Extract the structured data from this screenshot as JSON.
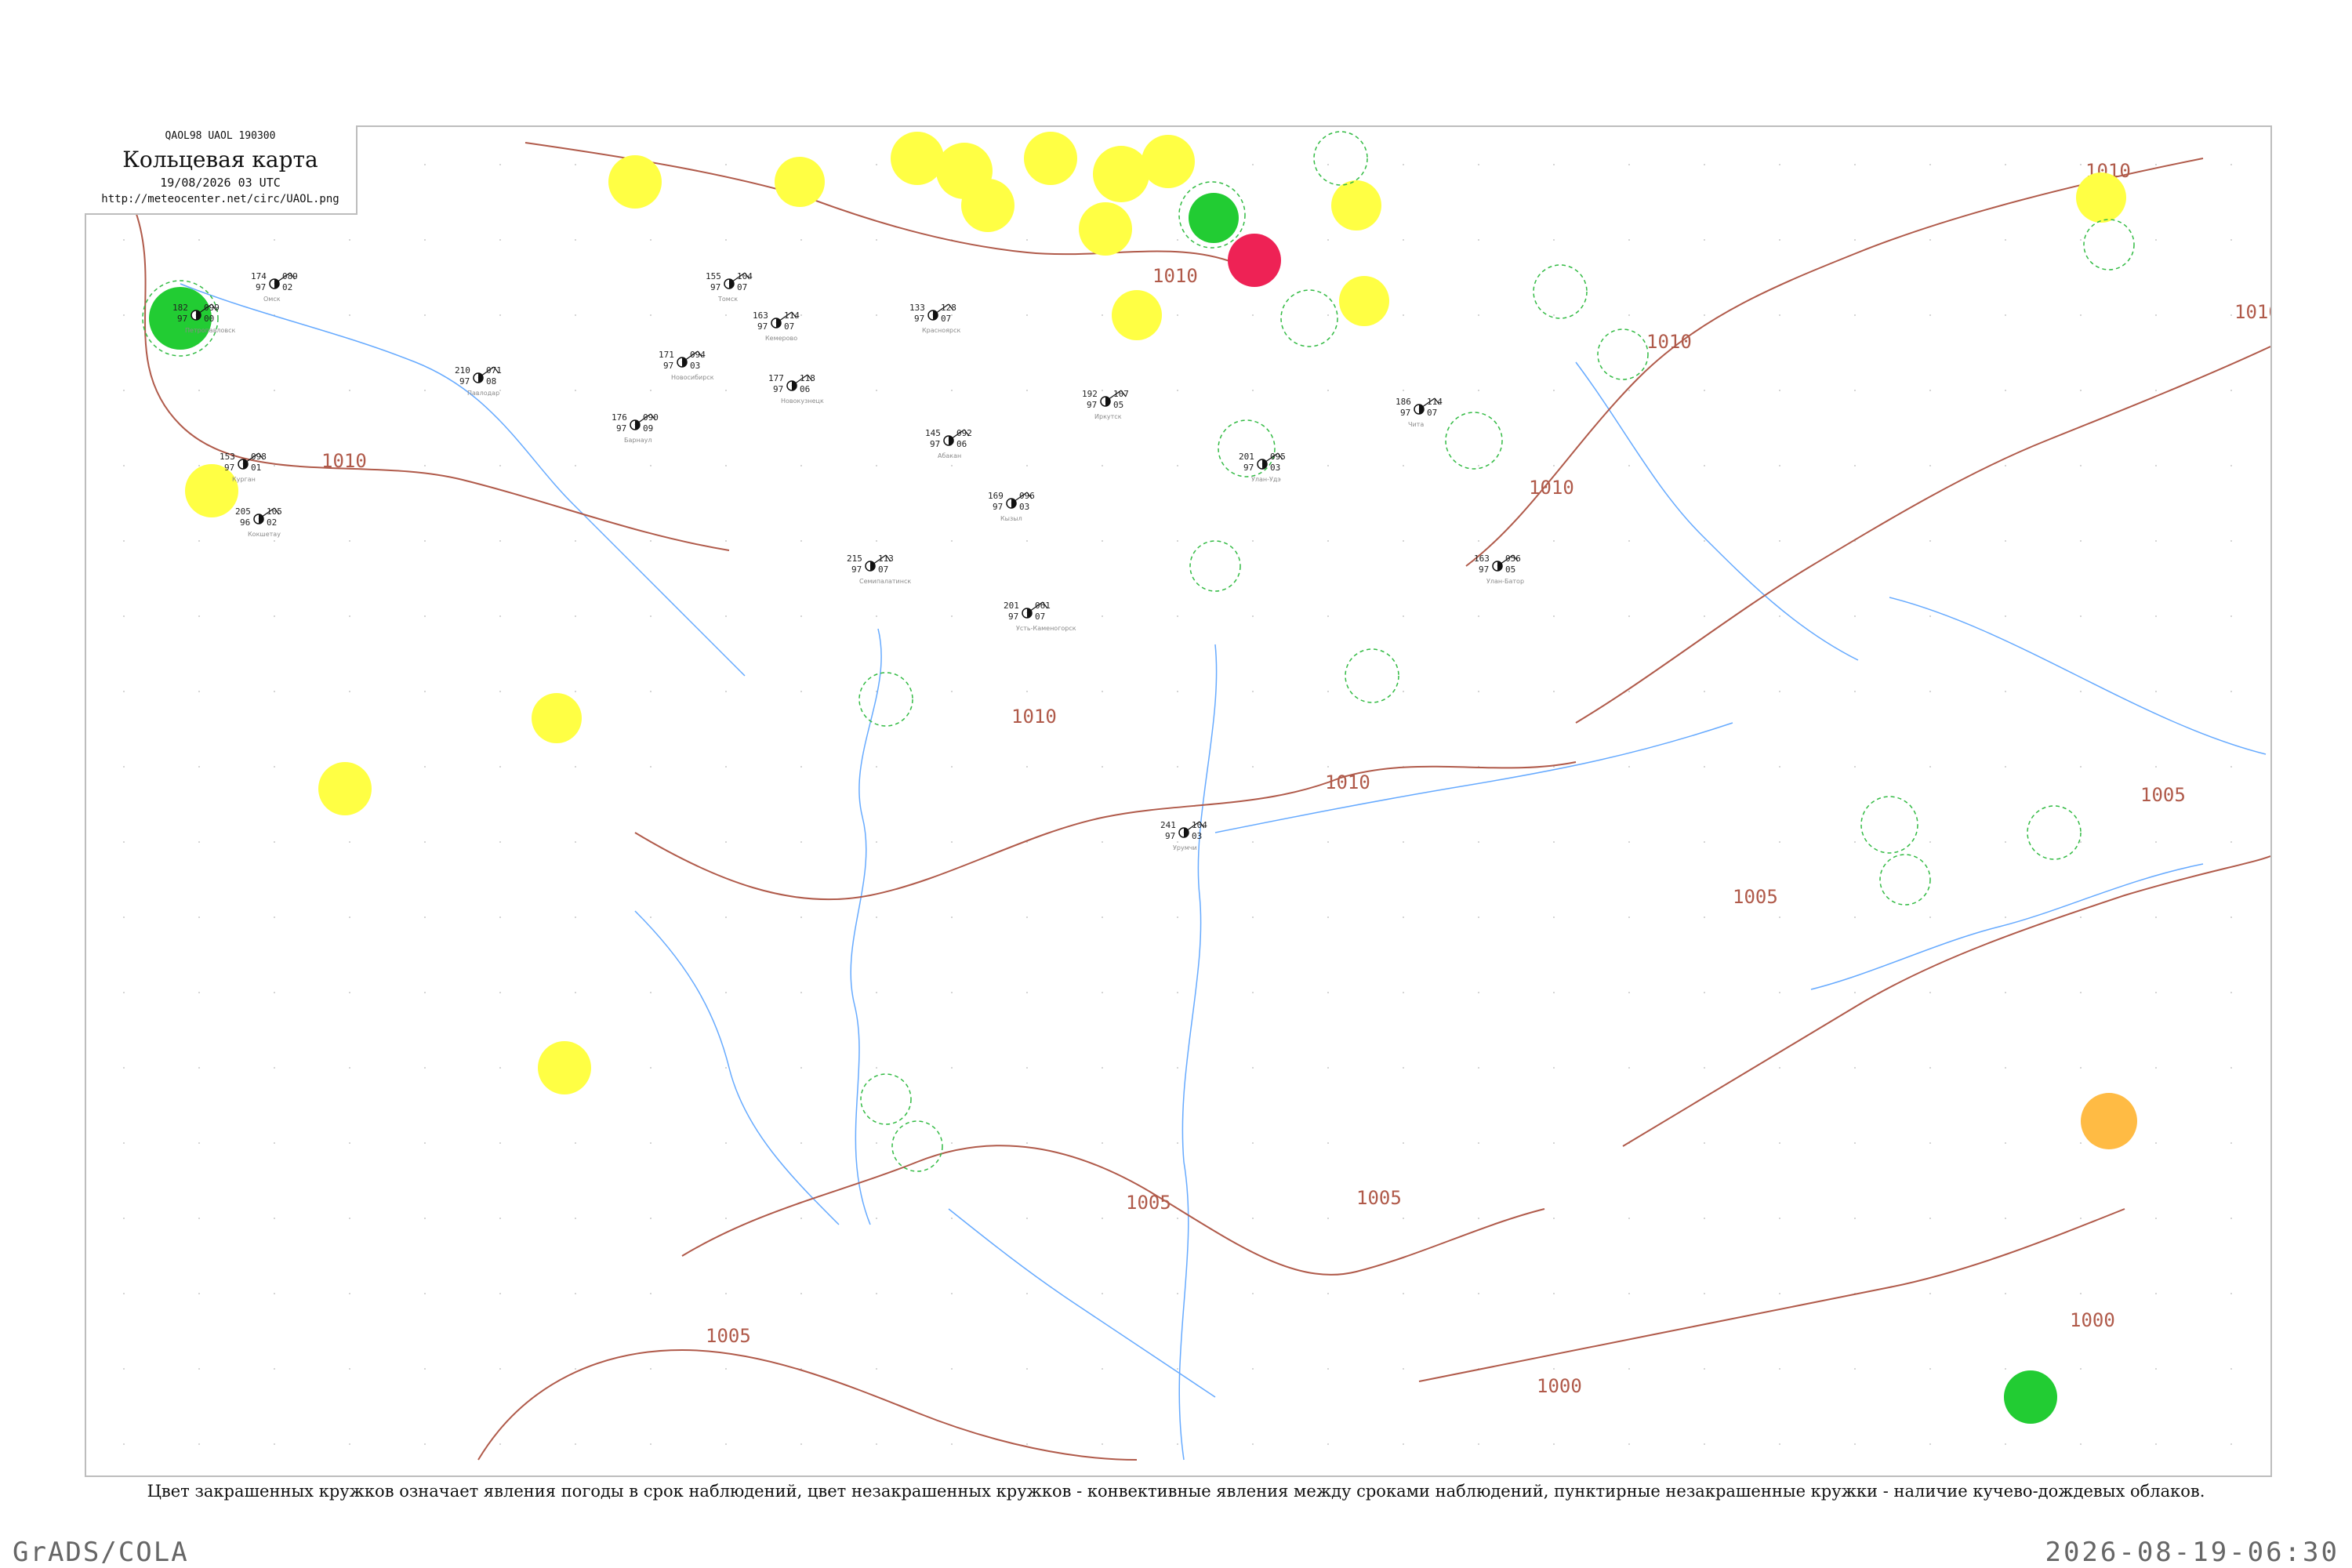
{
  "header": {
    "code_line": "QAOL98 UAOL 190300",
    "title": "Кольцевая карта",
    "datetime": "19/08/2026 03 UTC",
    "url": "http://meteocenter.net/circ/UAOL.png"
  },
  "caption": "Цвет закрашенных кружков означает явления погоды в срок наблюдений, цвет незакрашенных кружков - конвективные явления между сроками наблюдений, пунктирные незакрашенные кружки - наличие кучево-дождевых облаков.",
  "footer": {
    "left": "GrADS/COLA",
    "right": "2026-08-19-06:30"
  },
  "isobars": [
    {
      "label": "1010"
    },
    {
      "label": "1010"
    },
    {
      "label": "1010"
    },
    {
      "label": "1010"
    },
    {
      "label": "1010"
    },
    {
      "label": "1010"
    },
    {
      "label": "1010"
    },
    {
      "label": "1010"
    },
    {
      "label": "1005"
    },
    {
      "label": "1005"
    },
    {
      "label": "1005"
    },
    {
      "label": "1005"
    },
    {
      "label": "1005"
    },
    {
      "label": "1000"
    },
    {
      "label": "1000"
    }
  ],
  "colors": {
    "yellow": "#ffff44",
    "green": "#22cc33",
    "red": "#ee2255",
    "orange": "#ffbb44",
    "isobar": "#b05a4a",
    "river": "#66aaff",
    "dashed": "#33bb44"
  },
  "stations": [
    {
      "name": "Курган",
      "temp": "153",
      "pres": "098",
      "dew": "97",
      "vis": "01"
    },
    {
      "name": "Кокшетау",
      "temp": "205",
      "pres": "105",
      "dew": "96",
      "vis": "02"
    },
    {
      "name": "Петропавловск",
      "temp": "182",
      "pres": "099",
      "dew": "97",
      "vis": "00"
    },
    {
      "name": "Омск",
      "temp": "174",
      "pres": "089",
      "dew": "97",
      "vis": "02"
    },
    {
      "name": "Павлодар",
      "temp": "210",
      "pres": "071",
      "dew": "97",
      "vis": "08"
    },
    {
      "name": "Барнаул",
      "temp": "176",
      "pres": "090",
      "dew": "97",
      "vis": "09"
    },
    {
      "name": "Новосибирск",
      "temp": "171",
      "pres": "094",
      "dew": "97",
      "vis": "03"
    },
    {
      "name": "Томск",
      "temp": "155",
      "pres": "104",
      "dew": "97",
      "vis": "07"
    },
    {
      "name": "Кемерово",
      "temp": "163",
      "pres": "114",
      "dew": "97",
      "vis": "07"
    },
    {
      "name": "Новокузнецк",
      "temp": "177",
      "pres": "118",
      "dew": "97",
      "vis": "06"
    },
    {
      "name": "Красноярск",
      "temp": "133",
      "pres": "128",
      "dew": "97",
      "vis": "07"
    },
    {
      "name": "Абакан",
      "temp": "145",
      "pres": "092",
      "dew": "97",
      "vis": "06"
    },
    {
      "name": "Кызыл",
      "temp": "169",
      "pres": "096",
      "dew": "97",
      "vis": "03"
    },
    {
      "name": "Иркутск",
      "temp": "192",
      "pres": "107",
      "dew": "97",
      "vis": "05"
    },
    {
      "name": "Улан-Удэ",
      "temp": "201",
      "pres": "095",
      "dew": "97",
      "vis": "03"
    },
    {
      "name": "Чита",
      "temp": "186",
      "pres": "114",
      "dew": "97",
      "vis": "07"
    },
    {
      "name": "Улан-Батор",
      "temp": "163",
      "pres": "056",
      "dew": "97",
      "vis": "05"
    },
    {
      "name": "Урумчи",
      "temp": "241",
      "pres": "104",
      "dew": "97",
      "vis": "03"
    },
    {
      "name": "Семипалатинск",
      "temp": "215",
      "pres": "113",
      "dew": "97",
      "vis": "07"
    },
    {
      "name": "Усть-Каменогорск",
      "temp": "201",
      "pres": "061",
      "dew": "97",
      "vis": "07"
    }
  ]
}
